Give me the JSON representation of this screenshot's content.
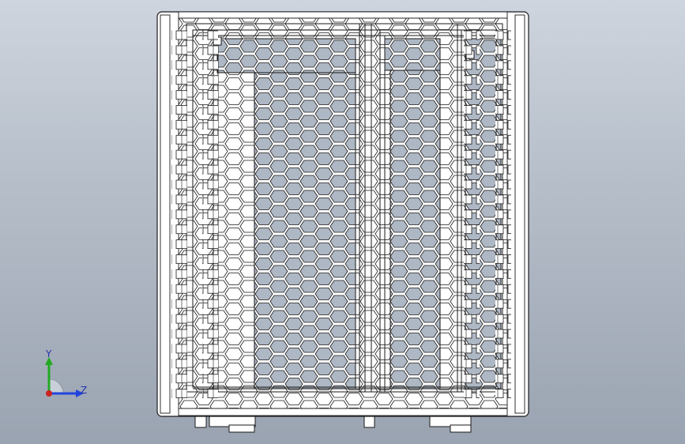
{
  "viewport": {
    "background_top": "#cfd5de",
    "background_bottom": "#9aa3b1"
  },
  "model": {
    "part": "perforated-hex-mesh-cabinet",
    "line_color": "#1a1a1a",
    "body_color": "#ffffff",
    "hole_color": "#aeb7c4"
  },
  "triad": {
    "y_label": "Y",
    "z_label": "Z",
    "y_color": "#22aa22",
    "z_color": "#2244dd",
    "x_color": "#cc2222"
  }
}
